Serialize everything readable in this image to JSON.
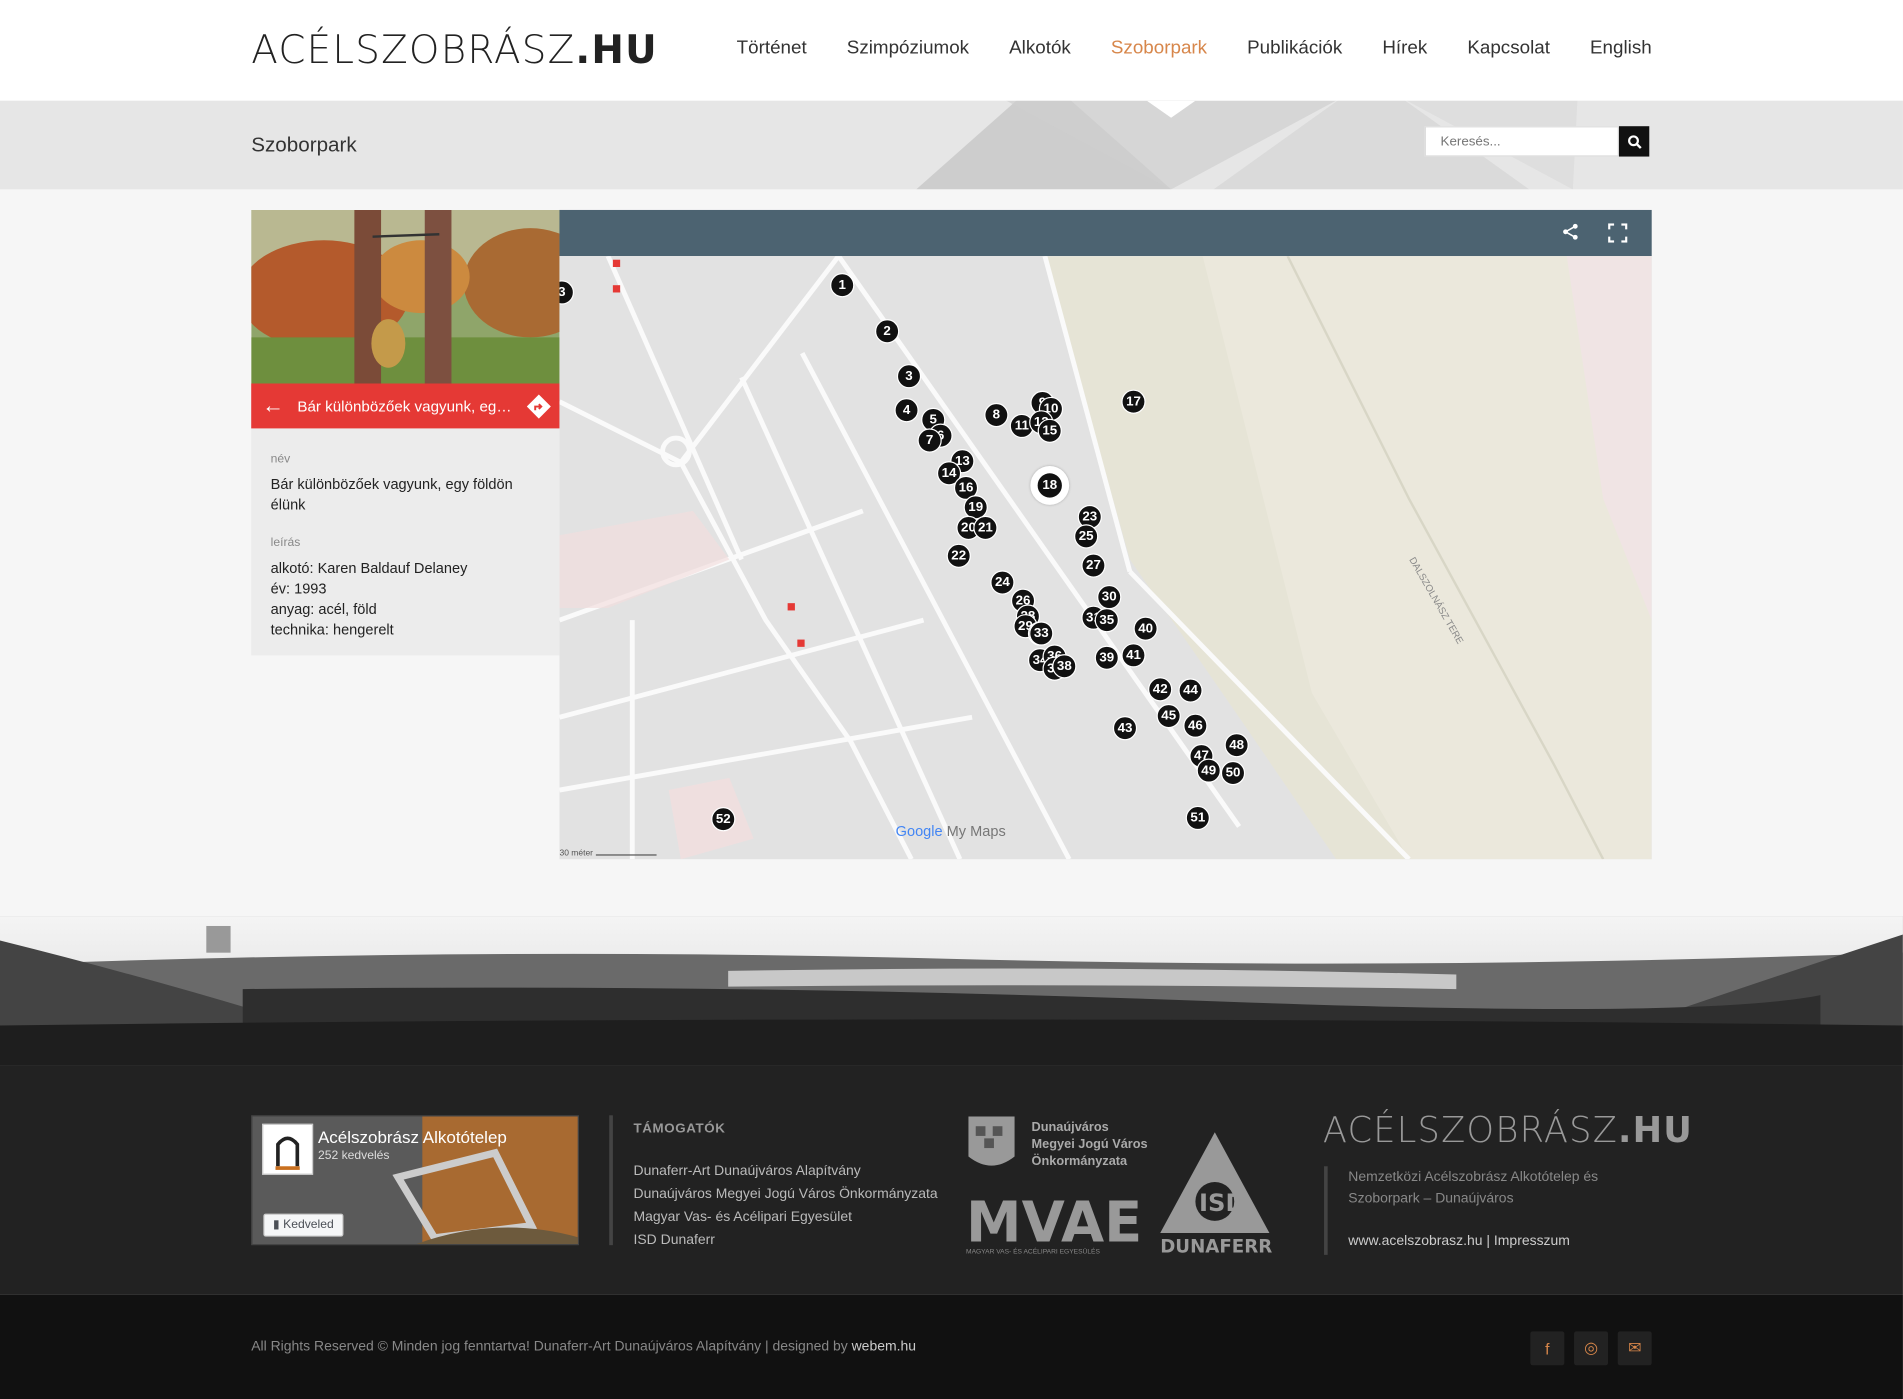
{
  "header": {
    "logo_main": "ACÉLSZOBRÁSZ",
    "logo_tld": ".HU",
    "nav": [
      "Történet",
      "Szimpóziumok",
      "Alkotók",
      "Szoborpark",
      "Publikációk",
      "Hírek",
      "Kapcsolat",
      "English"
    ],
    "active_nav": "Szoborpark"
  },
  "page": {
    "title": "Szoborpark",
    "search_placeholder": "Keresés..."
  },
  "map": {
    "detail_title": "Bár különbözőek vagyunk, egy f...",
    "name_label": "név",
    "name_value": "Bár különbözőek vagyunk, egy földön élünk",
    "desc_label": "leírás",
    "desc_lines": [
      "alkotó: Karen Baldauf Delaney",
      "év: 1993",
      "anyag: acél, föld",
      "technika: hengerelt"
    ],
    "attribution": "Google My Maps",
    "attribution_g": "Google",
    "attribution_m": "My Maps",
    "scale_label": "30 méter",
    "river_label": "DALSZOLNÁSZ TERE",
    "markers": [
      "1",
      "2",
      "3",
      "4",
      "5",
      "6",
      "7",
      "8",
      "9",
      "10",
      "11",
      "12",
      "13",
      "14",
      "15",
      "16",
      "17",
      "18",
      "19",
      "20",
      "21",
      "22",
      "23",
      "24",
      "25",
      "26",
      "27",
      "28",
      "29",
      "30",
      "31",
      "32",
      "33",
      "34",
      "35",
      "36",
      "37",
      "38",
      "39",
      "40",
      "41",
      "42",
      "43",
      "44",
      "45",
      "46",
      "47",
      "48",
      "49",
      "50",
      "51",
      "52",
      "3"
    ],
    "selected_marker": "18"
  },
  "footer": {
    "fb_name": "Acélszobrász Alkotótelep",
    "fb_likes": "252 kedvelés",
    "fb_button": "Kedveled",
    "sponsors_title": "TÁMOGATÓK",
    "sponsors": [
      "Dunaferr-Art Dunaújváros Alapítvány",
      "Dunaújváros Megyei Jogú Város Önkormányzata",
      "Magyar Vas- és Acélipari Egyesület",
      "ISD Dunaferr"
    ],
    "city_lines": [
      "Dunaújváros",
      "Megyei Jogú Város",
      "Önkormányzata"
    ],
    "mvae_text": "MVAE",
    "mvae_sub": "MAGYAR VAS- ÉS ACÉLIPARI EGYESÜLÉS",
    "isd_text": "ISD",
    "isd_sub": "DUNAFERR",
    "logo_main": "ACÉLSZOBRÁSZ",
    "logo_tld": ".HU",
    "desc": "Nemzetközi Acélszobrász Alkotótelep és Szoborpark – Dunaújváros",
    "site_link": "www.acelszobrasz.hu",
    "sep": "|",
    "impressum": "Impresszum"
  },
  "bottom": {
    "copyright": "All Rights Reserved © Minden jog fenntartva! Dunaferr-Art Dunaújváros Alapítvány | designed by ",
    "designer": "webem.hu",
    "social": [
      "f",
      "◎",
      "✉"
    ]
  },
  "colors": {
    "accent": "#d7864a",
    "map_header": "#4c6371",
    "red": "#e53935"
  }
}
